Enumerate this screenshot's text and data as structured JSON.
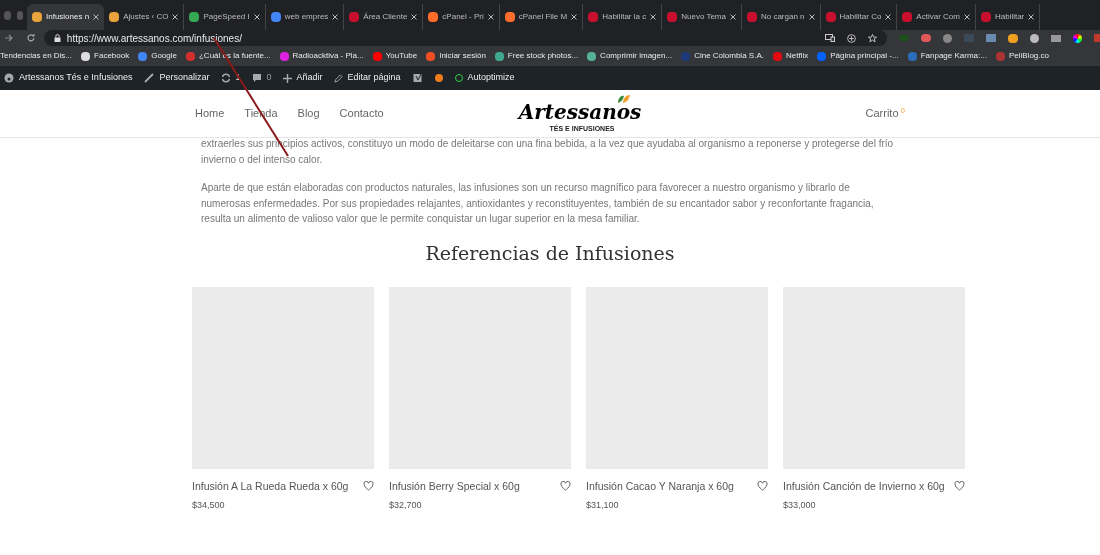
{
  "browser": {
    "tabs": [
      {
        "title": "Infusiones n",
        "selected": true
      },
      {
        "title": "Ajustes ‹ CO",
        "selected": false
      },
      {
        "title": "PageSpeed I",
        "selected": false
      },
      {
        "title": "web empres",
        "selected": false
      },
      {
        "title": "Área Cliente",
        "selected": false
      },
      {
        "title": "cPanel - Pri",
        "selected": false
      },
      {
        "title": "cPanel File M",
        "selected": false
      },
      {
        "title": "Habilitar la c",
        "selected": false
      },
      {
        "title": "Nuevo Tema",
        "selected": false
      },
      {
        "title": "No cargan n",
        "selected": false
      },
      {
        "title": "Habilitar Co",
        "selected": false
      },
      {
        "title": "Activar Com",
        "selected": false
      },
      {
        "title": "Habilitar",
        "selected": false
      }
    ],
    "url": "https://www.artessanos.com/infusiones/",
    "bookmarks": [
      "Tendencias en Dis...",
      "Facebook",
      "Google",
      "¿Cuál es la fuente...",
      "Radioacktiva - Pla...",
      "YouTube",
      "Iniciar sesión",
      "Free stock photos...",
      "Comprimir imagen...",
      "Cine Colombia S.A.",
      "Netflix",
      "Página principal -...",
      "Fanpage Karma:...",
      "PeliBlog.co"
    ]
  },
  "admin_bar": {
    "site": "Artessanos Tés e Infusiones",
    "customize": "Personalizar",
    "updates": "1",
    "comments": "0",
    "add": "Añadir",
    "edit": "Editar página",
    "autoptimize": "Autoptimize"
  },
  "site_header": {
    "nav": [
      "Home",
      "Tienda",
      "Blog",
      "Contacto"
    ],
    "logo": "Artessanos",
    "tagline": "TÉS E INFUSIONES",
    "cart": "Carrito",
    "cart_count": "0"
  },
  "content": {
    "paragraphs": [
      "extraerles sus principios activos, constituyo un modo de deleitarse con una fina bebida, a la vez que ayudaba al organismo a reponerse y protegerse del frío invierno o del intenso calor.",
      "Aparte de que están elaboradas con productos naturales, las infusiones son un recurso magnífico para favorecer a nuestro organismo y librarlo de numerosas enfermedades. Por sus propiedades relajantes, antioxidantes y reconstituyentes, también de su encantador sabor y reconfortante fragancia, resulta un alimento de valioso valor que le permite conquistar un lugar superior  en la mesa familiar."
    ],
    "heading": "Referencias de Infusiones",
    "products": [
      {
        "name": "Infusión A La Rueda Rueda x 60g",
        "price": "$34,500"
      },
      {
        "name": "Infusión Berry Special x 60g",
        "price": "$32,700"
      },
      {
        "name": "Infusión Cacao Y Naranja x 60g",
        "price": "$31,100"
      },
      {
        "name": "Infusión Canción de Invierno x 60g",
        "price": "$33,000"
      }
    ]
  }
}
